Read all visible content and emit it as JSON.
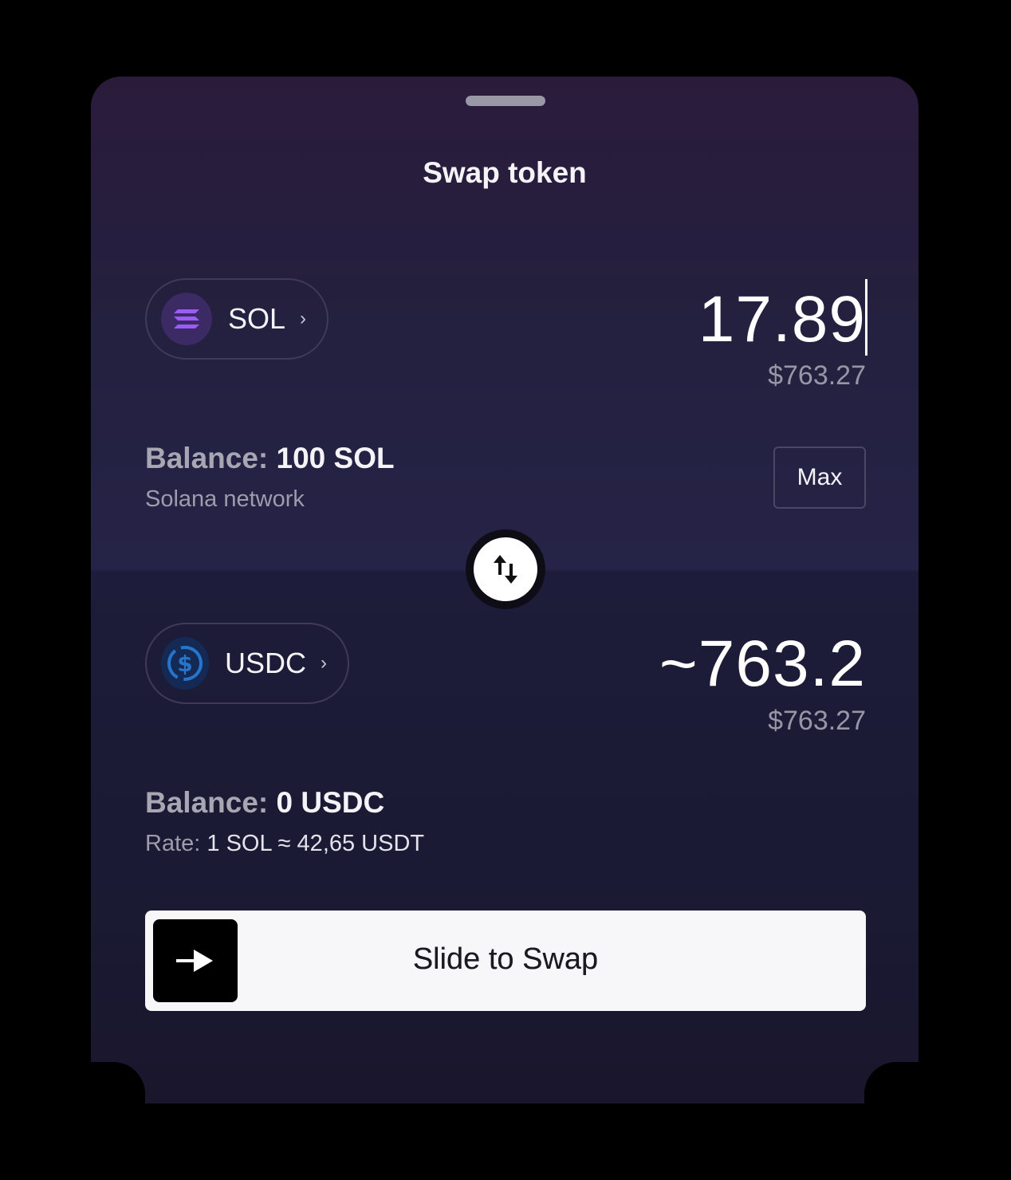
{
  "sheet": {
    "title": "Swap token"
  },
  "from": {
    "symbol": "SOL",
    "icon": "solana-icon",
    "amount": "17.89",
    "fiat": "$763.27",
    "balance_label": "Balance:",
    "balance_value": "100 SOL",
    "network": "Solana network",
    "max_label": "Max"
  },
  "to": {
    "symbol": "USDC",
    "icon": "usdc-icon",
    "amount": "~763.2",
    "fiat": "$763.27",
    "balance_label": "Balance:",
    "balance_value": "0 USDC",
    "rate_label": "Rate:",
    "rate_value": "1 SOL ≈ 42,65 USDT"
  },
  "action": {
    "slider_label": "Slide to Swap"
  },
  "colors": {
    "background": "#000000",
    "sol_accent": "#9b5cf6",
    "usdc_accent": "#2775ca",
    "slider_bg": "#f7f6f8"
  }
}
